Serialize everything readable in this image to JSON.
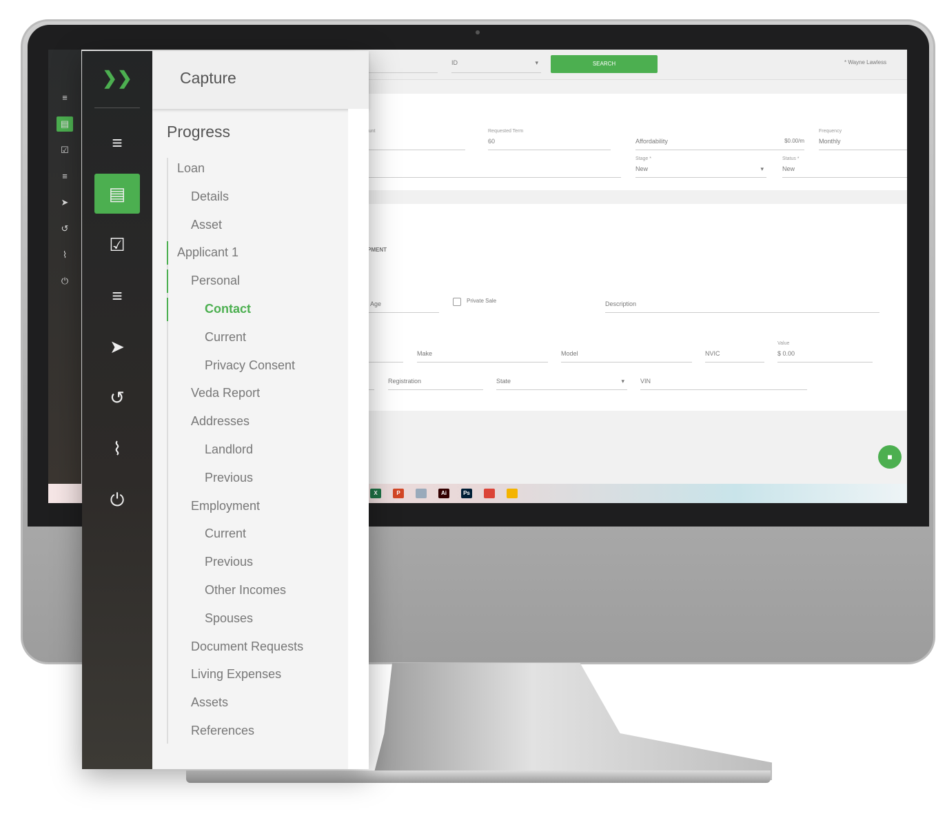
{
  "topbar": {
    "search_field_partial": "d",
    "id_select": "ID",
    "search_label": "SEARCH",
    "user": "* Wayne Lawless"
  },
  "loan": {
    "amount_label": "mount",
    "term_label": "Requested Term",
    "term_value": "60",
    "affordability_label": "Affordability",
    "affordability_value": "$0.00/m",
    "frequency_label": "Frequency",
    "frequency_value": "Monthly",
    "stage_label": "Stage *",
    "stage_value": "New",
    "status_label": "Status *",
    "status_value": "New"
  },
  "asset": {
    "section": "UIPMENT",
    "age_label": "ed Age",
    "private_sale": "Private Sale",
    "description": "Description",
    "make": "Make",
    "model": "Model",
    "nvic": "NVIC",
    "value_label": "Value",
    "value": "$ 0.00",
    "prefix": "m",
    "registration": "Registration",
    "state": "State",
    "vin": "VIN"
  },
  "taskbar": {
    "apps": [
      "excel-icon",
      "powerpoint-icon",
      "file-icon",
      "illustrator-icon",
      "photoshop-icon",
      "chrome-icon",
      "drive-icon"
    ],
    "labels": [
      "X",
      "P",
      "",
      "Ai",
      "Ps",
      "",
      ""
    ]
  },
  "panel": {
    "title": "Capture",
    "progress": "Progress",
    "items": [
      {
        "label": "Loan",
        "level": 0
      },
      {
        "label": "Details",
        "level": 1
      },
      {
        "label": "Asset",
        "level": 1
      },
      {
        "label": "Applicant 1",
        "level": 0,
        "marked": true
      },
      {
        "label": "Personal",
        "level": 1,
        "marked": true
      },
      {
        "label": "Contact",
        "level": 2,
        "active": true
      },
      {
        "label": "Current",
        "level": 2
      },
      {
        "label": "Privacy Consent",
        "level": 2
      },
      {
        "label": "Veda Report",
        "level": 1
      },
      {
        "label": "Addresses",
        "level": 1
      },
      {
        "label": "Landlord",
        "level": 2
      },
      {
        "label": "Previous",
        "level": 2
      },
      {
        "label": "Employment",
        "level": 1
      },
      {
        "label": "Current",
        "level": 2
      },
      {
        "label": "Previous",
        "level": 2
      },
      {
        "label": "Other Incomes",
        "level": 2
      },
      {
        "label": "Spouses",
        "level": 2
      },
      {
        "label": "Document Requests",
        "level": 1
      },
      {
        "label": "Living Expenses",
        "level": 1
      },
      {
        "label": "Assets",
        "level": 1
      },
      {
        "label": "References",
        "level": 1
      }
    ]
  },
  "sidebar": {
    "icons": [
      "search-list-icon",
      "clipboard-icon",
      "checklist-icon",
      "clear-list-icon",
      "send-icon",
      "history-icon",
      "attachment-icon",
      "plug-icon"
    ],
    "active": 1
  },
  "colors": {
    "accent": "#4caf50",
    "sidebar": "#232526"
  }
}
